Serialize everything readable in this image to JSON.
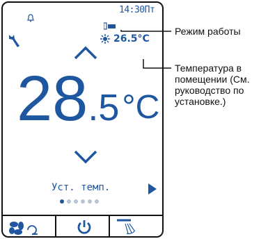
{
  "screen": {
    "clock": "14:30Пт",
    "mode_temp": "26.5°C",
    "big_temp_int": "28",
    "big_temp_dec": ".5",
    "big_temp_unit": "°C",
    "set_label": "Уст. темп.",
    "page_dots_total": 6,
    "page_dot_active": 1,
    "icons": [
      "bell-icon",
      "wrench-icon",
      "filter-battery-icon",
      "up-arrow-icon",
      "down-arrow-icon",
      "fan-mode-icon",
      "right-arrow-icon",
      "fan-speed-icon",
      "power-icon",
      "vane-icon"
    ],
    "accent_color": "#1e56a0"
  },
  "callouts": {
    "mode": "Режим работы",
    "room_temp_line1": "Температура в",
    "room_temp_line2": "помещении (См.",
    "room_temp_line3": "руководство по",
    "room_temp_line4": "установке.)"
  }
}
